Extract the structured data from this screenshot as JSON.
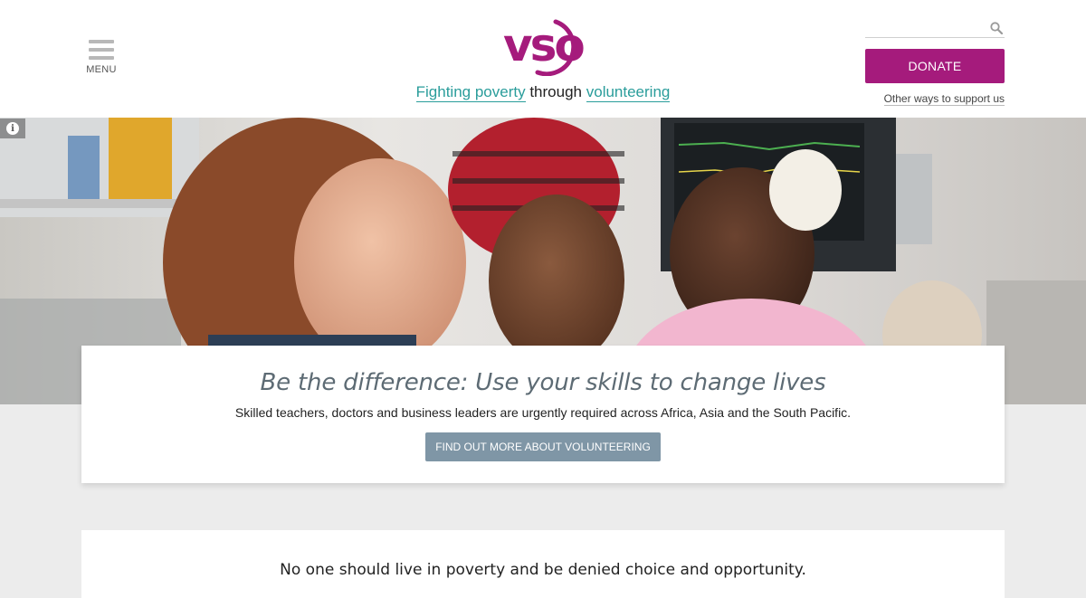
{
  "header": {
    "menu_label": "MENU",
    "logo_text": "vso",
    "tagline_part1": "Fighting poverty",
    "tagline_part2": "through",
    "tagline_part3": "volunteering",
    "search_placeholder": "",
    "donate_label": "DONATE",
    "other_ways_label": "Other ways to support us"
  },
  "colors": {
    "brand": "#a51b7c",
    "teal": "#2a9d9b",
    "cta": "#7f96a6"
  },
  "hero": {
    "info_icon": "i"
  },
  "callout": {
    "heading": "Be the difference: Use your skills to change lives",
    "body": "Skilled teachers, doctors and business leaders are urgently required across Africa, Asia and the South Pacific.",
    "cta_label": "FIND OUT MORE ABOUT VOLUNTEERING"
  },
  "mission": {
    "text": "No one should live in poverty and be denied choice and opportunity."
  }
}
